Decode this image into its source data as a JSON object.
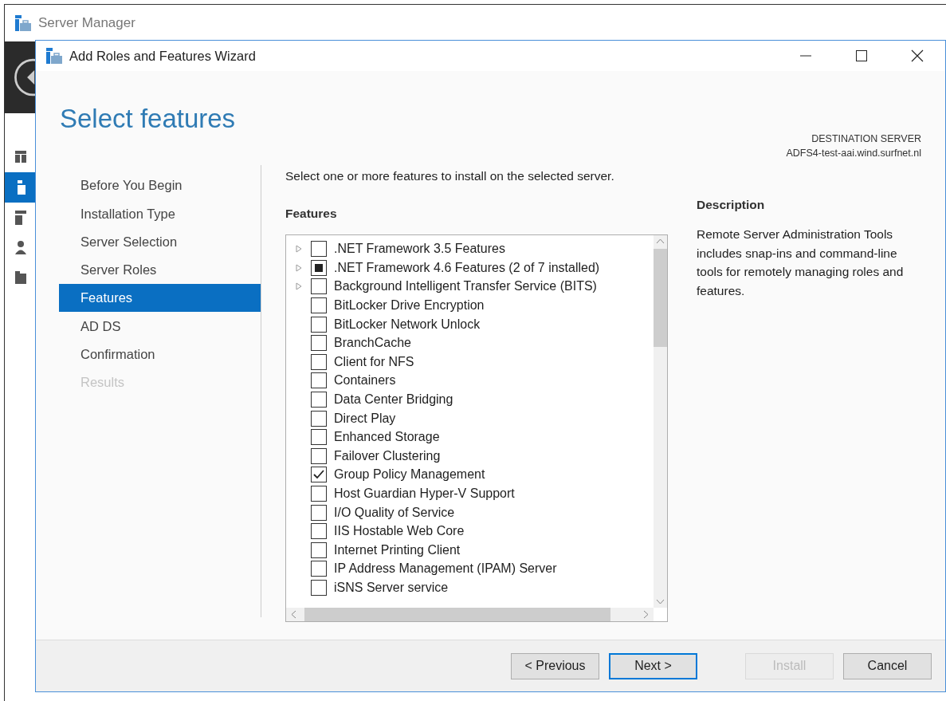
{
  "background_window": {
    "title": "Server Manager",
    "nav_items": [
      {
        "selected": false
      },
      {
        "selected": true
      },
      {
        "selected": false
      },
      {
        "selected": false
      },
      {
        "selected": false
      }
    ]
  },
  "window": {
    "title": "Add Roles and Features Wizard"
  },
  "heading": "Select features",
  "destination": {
    "label": "DESTINATION SERVER",
    "server": "ADFS4-test-aai.wind.surfnet.nl"
  },
  "steps": [
    {
      "label": "Before You Begin",
      "selected": false,
      "disabled": false
    },
    {
      "label": "Installation Type",
      "selected": false,
      "disabled": false
    },
    {
      "label": "Server Selection",
      "selected": false,
      "disabled": false
    },
    {
      "label": "Server Roles",
      "selected": false,
      "disabled": false
    },
    {
      "label": "Features",
      "selected": true,
      "disabled": false
    },
    {
      "label": "AD DS",
      "selected": false,
      "disabled": false
    },
    {
      "label": "Confirmation",
      "selected": false,
      "disabled": false
    },
    {
      "label": "Results",
      "selected": false,
      "disabled": true
    }
  ],
  "instruction": "Select one or more features to install on the selected server.",
  "features_heading": "Features",
  "features": [
    {
      "label": ".NET Framework 3.5 Features",
      "expandable": true,
      "checked": false,
      "partial": false
    },
    {
      "label": ".NET Framework 4.6 Features (2 of 7 installed)",
      "expandable": true,
      "checked": false,
      "partial": true
    },
    {
      "label": "Background Intelligent Transfer Service (BITS)",
      "expandable": true,
      "checked": false,
      "partial": false
    },
    {
      "label": "BitLocker Drive Encryption",
      "expandable": false,
      "checked": false,
      "partial": false
    },
    {
      "label": "BitLocker Network Unlock",
      "expandable": false,
      "checked": false,
      "partial": false
    },
    {
      "label": "BranchCache",
      "expandable": false,
      "checked": false,
      "partial": false
    },
    {
      "label": "Client for NFS",
      "expandable": false,
      "checked": false,
      "partial": false
    },
    {
      "label": "Containers",
      "expandable": false,
      "checked": false,
      "partial": false
    },
    {
      "label": "Data Center Bridging",
      "expandable": false,
      "checked": false,
      "partial": false
    },
    {
      "label": "Direct Play",
      "expandable": false,
      "checked": false,
      "partial": false
    },
    {
      "label": "Enhanced Storage",
      "expandable": false,
      "checked": false,
      "partial": false
    },
    {
      "label": "Failover Clustering",
      "expandable": false,
      "checked": false,
      "partial": false
    },
    {
      "label": "Group Policy Management",
      "expandable": false,
      "checked": true,
      "partial": false
    },
    {
      "label": "Host Guardian Hyper-V Support",
      "expandable": false,
      "checked": false,
      "partial": false
    },
    {
      "label": "I/O Quality of Service",
      "expandable": false,
      "checked": false,
      "partial": false
    },
    {
      "label": "IIS Hostable Web Core",
      "expandable": false,
      "checked": false,
      "partial": false
    },
    {
      "label": "Internet Printing Client",
      "expandable": false,
      "checked": false,
      "partial": false
    },
    {
      "label": "IP Address Management (IPAM) Server",
      "expandable": false,
      "checked": false,
      "partial": false
    },
    {
      "label": "iSNS Server service",
      "expandable": false,
      "checked": false,
      "partial": false
    }
  ],
  "description": {
    "heading": "Description",
    "text": "Remote Server Administration Tools includes snap-ins and command-line tools for remotely managing roles and features."
  },
  "buttons": [
    {
      "label": "< Previous",
      "default": false,
      "disabled": false
    },
    {
      "label": "Next >",
      "default": true,
      "disabled": false
    },
    {
      "label": "Install",
      "default": false,
      "disabled": true
    },
    {
      "label": "Cancel",
      "default": false,
      "disabled": false
    }
  ]
}
